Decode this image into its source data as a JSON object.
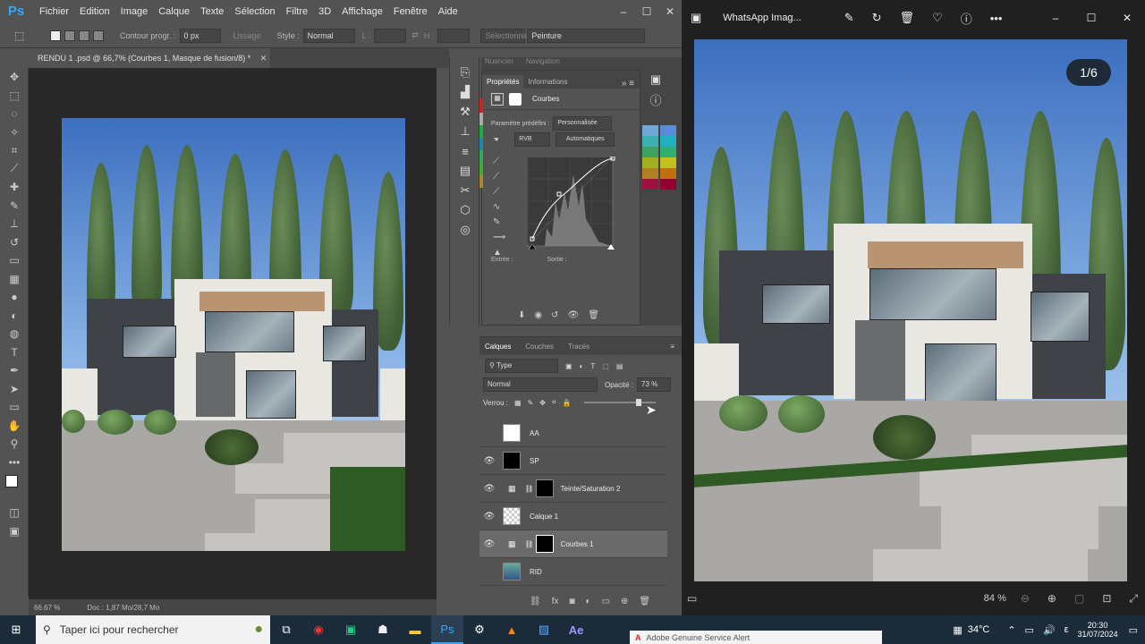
{
  "photoshop": {
    "logo": "Ps",
    "menu": [
      "Fichier",
      "Edition",
      "Image",
      "Calque",
      "Texte",
      "Sélection",
      "Filtre",
      "3D",
      "Affichage",
      "Fenêtre",
      "Aide"
    ],
    "options": {
      "contour_label": "Contour progr. :",
      "contour_value": "0 px",
      "lissage_label": "Lissage",
      "style_label": "Style :",
      "style_value": "Normal",
      "l_label": "L :",
      "h_label": "H :",
      "selectionner_label": "Sélectionner",
      "peinture_value": "Peinture"
    },
    "document_tab": "RENDU 1 .psd @ 66,7% (Courbes 1, Masque de fusion/8) *",
    "status": {
      "zoom": "66.67 %",
      "doc": "Doc : 1,87 Mo/28,7 Mo"
    },
    "panel_group_tabs": [
      "Nuancier",
      "Navigation"
    ],
    "properties": {
      "tabs": [
        "Propriétés",
        "Informations"
      ],
      "title": "Courbes",
      "preset_label": "Paramètre prédéfini :",
      "preset_value": "Personnalisée",
      "channel": "RVB",
      "auto_button": "Automatiques",
      "input_label": "Entrée :",
      "output_label": "Sortie :"
    },
    "layers_panel": {
      "tabs": [
        "Calques",
        "Couches",
        "Tracés"
      ],
      "filter": "Type",
      "blend_mode": "Normal",
      "opacity_label": "Opacité :",
      "opacity_value": "73 %",
      "lock_label": "Verrou :",
      "layers": [
        {
          "name": "AA",
          "visible": false
        },
        {
          "name": "SP",
          "visible": true
        },
        {
          "name": "Teinte/Saturation 2",
          "visible": true
        },
        {
          "name": "Calque 1",
          "visible": true
        },
        {
          "name": "Courbes 1",
          "visible": true
        },
        {
          "name": "RID",
          "visible": false
        }
      ]
    }
  },
  "viewer": {
    "title": "WhatsApp Imag...",
    "counter": "1/6",
    "zoom": "84 %"
  },
  "taskbar": {
    "search_placeholder": "Taper ici pour rechercher",
    "weather": "34°C",
    "time": "20:30",
    "date": "31/07/2024",
    "alert": "Adobe Genuine Service Alert",
    "lang": "ε"
  },
  "colors": {
    "ps_bg": "#535353",
    "ps_accent": "#31a8ff",
    "taskbar": "#1c2b3a"
  }
}
